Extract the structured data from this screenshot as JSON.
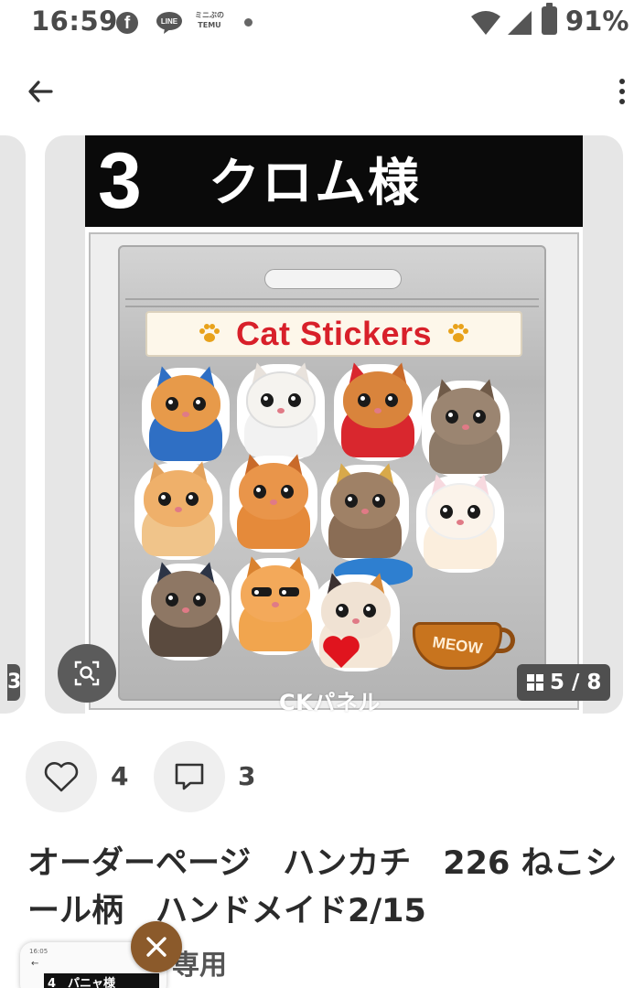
{
  "status_bar": {
    "time": "16:59",
    "temu_label": "ミニぶの TEMU",
    "battery_percent": "91%",
    "icons": [
      "facebook-icon",
      "line-icon",
      "temu-icon",
      "dot-icon",
      "wifi-icon",
      "signal-icon",
      "battery-icon"
    ]
  },
  "app_bar": {
    "back_icon": "arrow-left-icon",
    "menu_icon": "more-vertical-icon"
  },
  "gallery": {
    "order_number": "3",
    "order_name": "クロム様",
    "product_title": "Cat Stickers",
    "cup_text": "MEOW",
    "watermark": "CKパネル",
    "counter": "5 / 8",
    "prev_badge": "3",
    "lens_icon": "image-search-icon",
    "counter_icon": "grid-icon"
  },
  "actions": {
    "like_count": "4",
    "comment_count": "3"
  },
  "item": {
    "title": "オーダーページ　ハンカチ　226 ねこシール柄　ハンドメイド2/15"
  },
  "overlay": {
    "status_text": "専用",
    "mini_time": "16:05",
    "mini_banner": "4　パニャ様",
    "close_icon": "close-icon"
  },
  "colors": {
    "title_red": "#d8202a",
    "badge_dark": "#4f4f4f",
    "close_bubble": "#8b5a2b"
  }
}
